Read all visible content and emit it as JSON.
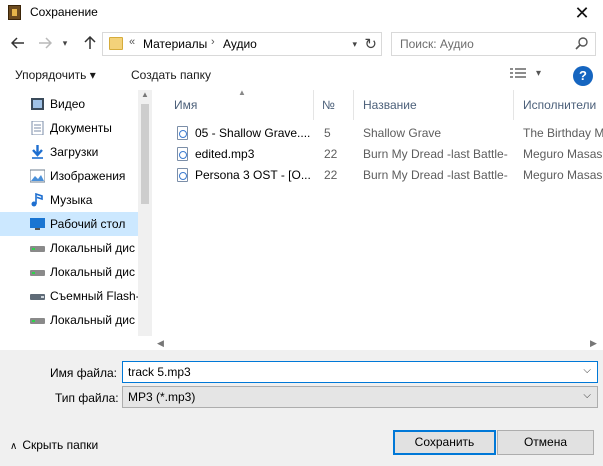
{
  "window": {
    "title": "Сохранение",
    "close_glyph": "✕"
  },
  "nav": {
    "back_icon": "arrow-left-icon",
    "forward_icon": "arrow-right-icon",
    "up_icon": "arrow-up-icon",
    "address": {
      "prefix": "«",
      "crumbs": [
        "Материалы",
        "Аудио"
      ]
    },
    "search_placeholder": "Поиск: Аудио"
  },
  "toolbar": {
    "organize_label": "Упорядочить ▾",
    "new_folder_label": "Создать папку",
    "help_label": "?"
  },
  "sidebar": {
    "items": [
      {
        "label": "Видео",
        "icon": "video-icon",
        "active": false
      },
      {
        "label": "Документы",
        "icon": "documents-icon",
        "active": false
      },
      {
        "label": "Загрузки",
        "icon": "downloads-icon",
        "active": false
      },
      {
        "label": "Изображения",
        "icon": "pictures-icon",
        "active": false
      },
      {
        "label": "Музыка",
        "icon": "music-icon",
        "active": false
      },
      {
        "label": "Рабочий стол",
        "icon": "desktop-icon",
        "active": true
      },
      {
        "label": "Локальный дис",
        "icon": "drive-icon",
        "active": false
      },
      {
        "label": "Локальный дис",
        "icon": "drive-icon",
        "active": false
      },
      {
        "label": "Съемный Flash-",
        "icon": "usb-drive-icon",
        "active": false
      },
      {
        "label": "Локальный дис",
        "icon": "drive-icon",
        "active": false
      }
    ]
  },
  "files": {
    "columns": [
      "Имя",
      "№",
      "Название",
      "Исполнители"
    ],
    "rows": [
      {
        "name": "05 - Shallow Grave....",
        "num": "5",
        "title": "Shallow Grave",
        "artist": "The Birthday M"
      },
      {
        "name": "edited.mp3",
        "num": "22",
        "title": "Burn My Dread -last Battle-",
        "artist": "Meguro Masash"
      },
      {
        "name": "Persona 3 OST - [O...",
        "num": "22",
        "title": "Burn My Dread -last Battle-",
        "artist": "Meguro Masash"
      }
    ]
  },
  "form": {
    "filename_label": "Имя файла:",
    "filename_value": "track 5.mp3",
    "filetype_label": "Тип файла:",
    "filetype_value": "MP3 (*.mp3)"
  },
  "footer": {
    "hide_folders_label": "Скрыть папки",
    "save_label": "Сохранить",
    "cancel_label": "Отмена"
  },
  "colors": {
    "accent": "#0078d7",
    "selection": "#cce8ff",
    "help": "#1565c0"
  }
}
